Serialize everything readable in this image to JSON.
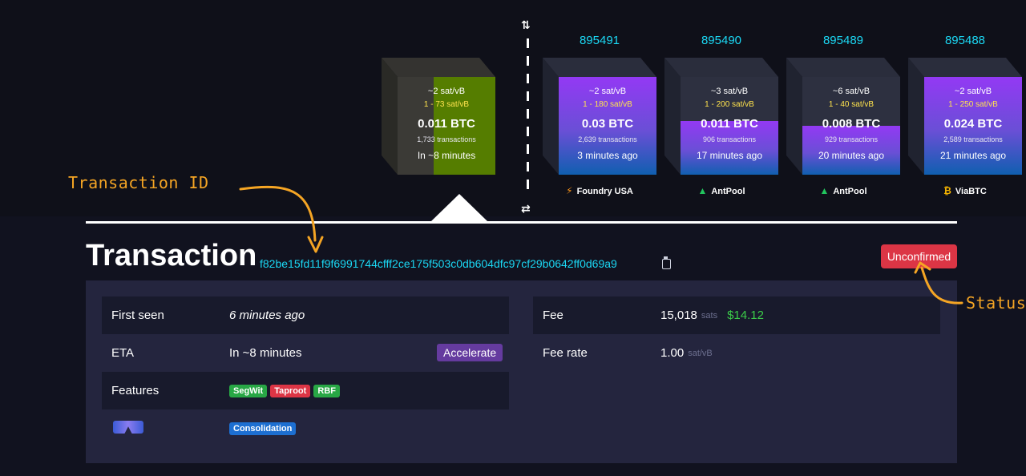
{
  "pending_block": {
    "fee": "~2 sat/vB",
    "fee_range": "1 - 73 sat/vB",
    "size": "0.011 BTC",
    "tx_count": "1,733 transactions",
    "time": "In ~8 minutes"
  },
  "mined_blocks": [
    {
      "height": "895491",
      "fee": "~2 sat/vB",
      "fee_range": "1 - 180 sat/vB",
      "size": "0.03 BTC",
      "tx_count": "2,639 transactions",
      "time": "3 minutes ago",
      "pool": "Foundry USA",
      "pool_icon": "foundry-icon",
      "fill": 1.0
    },
    {
      "height": "895490",
      "fee": "~3 sat/vB",
      "fee_range": "1 - 200 sat/vB",
      "size": "0.011 BTC",
      "tx_count": "906 transactions",
      "time": "17 minutes ago",
      "pool": "AntPool",
      "pool_icon": "antpool-icon",
      "fill": 0.55
    },
    {
      "height": "895489",
      "fee": "~6 sat/vB",
      "fee_range": "1 - 40 sat/vB",
      "size": "0.008 BTC",
      "tx_count": "929 transactions",
      "time": "20 minutes ago",
      "pool": "AntPool",
      "pool_icon": "antpool-icon",
      "fill": 0.5
    },
    {
      "height": "895488",
      "fee": "~2 sat/vB",
      "fee_range": "1 - 250 sat/vB",
      "size": "0.024 BTC",
      "tx_count": "2,589 transactions",
      "time": "21 minutes ago",
      "pool": "ViaBTC",
      "pool_icon": "viabtc-icon",
      "fill": 1.0
    }
  ],
  "transaction": {
    "title": "Transaction",
    "txid": "f82be15fd11f9f6991744cfff2ce175f503c0db604dfc97cf29b0642ff0d69a9",
    "status": "Unconfirmed"
  },
  "details_left": {
    "first_seen_label": "First seen",
    "first_seen_value": "6 minutes ago",
    "eta_label": "ETA",
    "eta_value": "In ~8 minutes",
    "accelerate_label": "Accelerate",
    "features_label": "Features",
    "features": [
      "SegWit",
      "Taproot",
      "RBF"
    ],
    "consolidation": "Consolidation"
  },
  "details_right": {
    "fee_label": "Fee",
    "fee_value": "15,018",
    "fee_unit": "sats",
    "fee_usd": "$14.12",
    "feerate_label": "Fee rate",
    "feerate_value": "1.00",
    "feerate_unit": "sat/vB"
  },
  "annotations": {
    "txid_label": "Transaction ID",
    "status_label": "Status"
  },
  "colors": {
    "accent": "#1bd8f4",
    "status_red": "#dc3545",
    "fee_yellow": "#ffe34d",
    "usd_green": "#3bcc49",
    "annotation": "#f5a524",
    "block_purple": "#9339f4",
    "block_blue": "#105fb0",
    "pending_green": "#557d00"
  }
}
